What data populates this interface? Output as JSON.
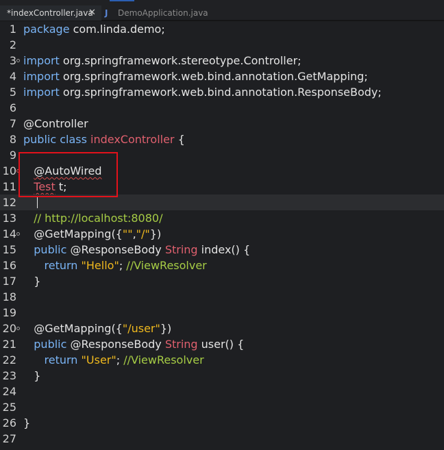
{
  "tabs": [
    {
      "label": "*indexController.java",
      "active": true,
      "close_icon": "close-x-icon"
    },
    {
      "label": "DemoApplication.java",
      "active": false,
      "file_icon": "J"
    }
  ],
  "lines": [
    {
      "n": "1",
      "tokens": [
        {
          "t": "package",
          "c": "kw"
        },
        {
          "t": " com.linda.demo;",
          "c": "pl"
        }
      ]
    },
    {
      "n": "2",
      "tokens": []
    },
    {
      "n": "3",
      "marker": "fold",
      "tokens": [
        {
          "t": "import",
          "c": "kw"
        },
        {
          "t": " org.springframework.stereotype.Controller;",
          "c": "pl"
        }
      ]
    },
    {
      "n": "4",
      "tokens": [
        {
          "t": "import",
          "c": "kw"
        },
        {
          "t": " org.springframework.web.bind.annotation.GetMapping;",
          "c": "pl"
        }
      ]
    },
    {
      "n": "5",
      "tokens": [
        {
          "t": "import",
          "c": "kw"
        },
        {
          "t": " org.springframework.web.bind.annotation.ResponseBody;",
          "c": "pl"
        }
      ]
    },
    {
      "n": "6",
      "tokens": []
    },
    {
      "n": "7",
      "tokens": [
        {
          "t": "@Controller",
          "c": "ann"
        }
      ]
    },
    {
      "n": "8",
      "tokens": [
        {
          "t": "public class ",
          "c": "kw"
        },
        {
          "t": "indexController",
          "c": "cls"
        },
        {
          "t": " {",
          "c": "pl"
        }
      ]
    },
    {
      "n": "9",
      "tokens": []
    },
    {
      "n": "10",
      "marker": "err",
      "tokens": [
        {
          "t": "   ",
          "c": "pl"
        },
        {
          "t": "@AutoWired",
          "c": "ann",
          "squiggle": true
        }
      ]
    },
    {
      "n": "11",
      "tokens": [
        {
          "t": "   ",
          "c": "pl"
        },
        {
          "t": "Test",
          "c": "cls",
          "squiggle": true
        },
        {
          "t": " t;",
          "c": "pl"
        }
      ]
    },
    {
      "n": "12",
      "current": true,
      "caret": true,
      "tokens": []
    },
    {
      "n": "13",
      "tokens": [
        {
          "t": "   ",
          "c": "pl"
        },
        {
          "t": "// http://localhost:8080/",
          "c": "cm"
        }
      ]
    },
    {
      "n": "14",
      "marker": "fold",
      "tokens": [
        {
          "t": "   @GetMapping({",
          "c": "pl"
        },
        {
          "t": "\"\"",
          "c": "str"
        },
        {
          "t": ",",
          "c": "pl"
        },
        {
          "t": "\"/\"",
          "c": "str"
        },
        {
          "t": "})",
          "c": "pl"
        }
      ]
    },
    {
      "n": "15",
      "tokens": [
        {
          "t": "   ",
          "c": "pl"
        },
        {
          "t": "public",
          "c": "kw"
        },
        {
          "t": " @ResponseBody ",
          "c": "pl"
        },
        {
          "t": "String",
          "c": "cls"
        },
        {
          "t": " index() {",
          "c": "pl"
        }
      ]
    },
    {
      "n": "16",
      "tokens": [
        {
          "t": "      ",
          "c": "pl"
        },
        {
          "t": "return",
          "c": "kw"
        },
        {
          "t": " ",
          "c": "pl"
        },
        {
          "t": "\"Hello\"",
          "c": "str"
        },
        {
          "t": "; ",
          "c": "pl"
        },
        {
          "t": "//ViewResolver",
          "c": "cm"
        }
      ]
    },
    {
      "n": "17",
      "tokens": [
        {
          "t": "   }",
          "c": "pl"
        }
      ]
    },
    {
      "n": "18",
      "tokens": []
    },
    {
      "n": "19",
      "tokens": []
    },
    {
      "n": "20",
      "marker": "fold",
      "tokens": [
        {
          "t": "   @GetMapping({",
          "c": "pl"
        },
        {
          "t": "\"/user\"",
          "c": "str"
        },
        {
          "t": "})",
          "c": "pl"
        }
      ]
    },
    {
      "n": "21",
      "tokens": [
        {
          "t": "   ",
          "c": "pl"
        },
        {
          "t": "public",
          "c": "kw"
        },
        {
          "t": " @ResponseBody ",
          "c": "pl"
        },
        {
          "t": "String",
          "c": "cls"
        },
        {
          "t": " user() {",
          "c": "pl"
        }
      ]
    },
    {
      "n": "22",
      "tokens": [
        {
          "t": "      ",
          "c": "pl"
        },
        {
          "t": "return",
          "c": "kw"
        },
        {
          "t": " ",
          "c": "pl"
        },
        {
          "t": "\"User\"",
          "c": "str"
        },
        {
          "t": "; ",
          "c": "pl"
        },
        {
          "t": "//ViewResolver",
          "c": "cm"
        }
      ]
    },
    {
      "n": "23",
      "tokens": [
        {
          "t": "   }",
          "c": "pl"
        }
      ]
    },
    {
      "n": "24",
      "tokens": []
    },
    {
      "n": "25",
      "tokens": []
    },
    {
      "n": "26",
      "tokens": [
        {
          "t": "}",
          "c": "pl"
        }
      ]
    },
    {
      "n": "27",
      "tokens": []
    }
  ],
  "colors": {
    "background": "#1e1f22",
    "keyword": "#7ab4f5",
    "class": "#e0606e",
    "string": "#f0b91e",
    "comment": "#a6cc45",
    "highlight_box": "#e3121b"
  }
}
